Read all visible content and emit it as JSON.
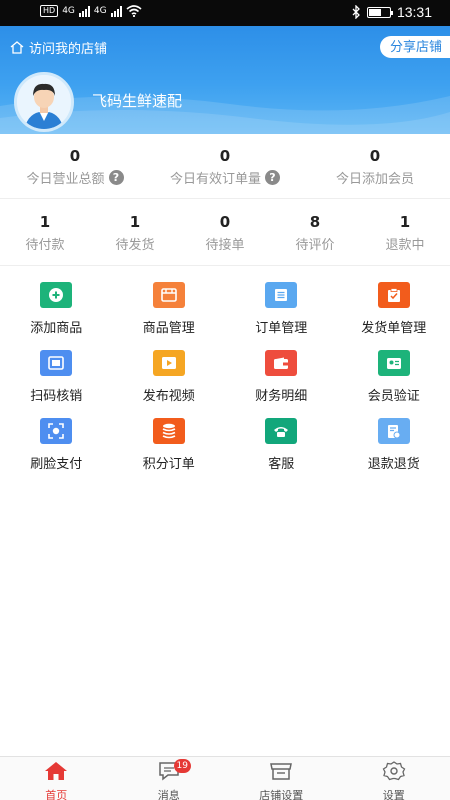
{
  "status_bar": {
    "hd": "HD",
    "network_1": "4G",
    "network_2": "4G",
    "time": "13:31",
    "battery_level": 0.6
  },
  "header": {
    "visit_label": "访问我的店铺",
    "share_label": "分享店铺",
    "store_name": "飞码生鲜速配"
  },
  "stats": [
    {
      "value": "0",
      "label": "今日营业总额",
      "help": true
    },
    {
      "value": "0",
      "label": "今日有效订单量",
      "help": true
    },
    {
      "value": "0",
      "label": "今日添加会员",
      "help": false
    }
  ],
  "help_glyph": "?",
  "orders": [
    {
      "value": "1",
      "label": "待付款"
    },
    {
      "value": "1",
      "label": "待发货"
    },
    {
      "value": "0",
      "label": "待接单"
    },
    {
      "value": "8",
      "label": "待评价"
    },
    {
      "value": "1",
      "label": "退款中"
    }
  ],
  "menu": [
    {
      "label": "添加商品",
      "icon": "add-product-icon",
      "color": "#1db37a"
    },
    {
      "label": "商品管理",
      "icon": "product-manage-icon",
      "color": "#f5813a"
    },
    {
      "label": "订单管理",
      "icon": "order-list-icon",
      "color": "#5aa8f0"
    },
    {
      "label": "发货单管理",
      "icon": "shipment-icon",
      "color": "#f25c1c"
    },
    {
      "label": "扫码核销",
      "icon": "scan-icon",
      "color": "#4e8ef0"
    },
    {
      "label": "发布视频",
      "icon": "video-icon",
      "color": "#f5a623"
    },
    {
      "label": "财务明细",
      "icon": "wallet-icon",
      "color": "#ee4d3d"
    },
    {
      "label": "会员验证",
      "icon": "member-card-icon",
      "color": "#1db37a"
    },
    {
      "label": "刷脸支付",
      "icon": "face-pay-icon",
      "color": "#4e8ef0"
    },
    {
      "label": "积分订单",
      "icon": "points-icon",
      "color": "#f25c1c"
    },
    {
      "label": "客服",
      "icon": "phone-icon",
      "color": "#12a77b"
    },
    {
      "label": "退款退货",
      "icon": "refund-icon",
      "color": "#68adf2"
    }
  ],
  "tabbar": {
    "items": [
      {
        "label": "首页",
        "icon": "home-icon",
        "active": true
      },
      {
        "label": "消息",
        "icon": "message-icon",
        "badge": "19"
      },
      {
        "label": "店铺设置",
        "icon": "store-settings-icon"
      },
      {
        "label": "设置",
        "icon": "gear-icon"
      }
    ]
  },
  "colors": {
    "accent_red": "#e53935",
    "header_blue": "#2d8fe8"
  }
}
